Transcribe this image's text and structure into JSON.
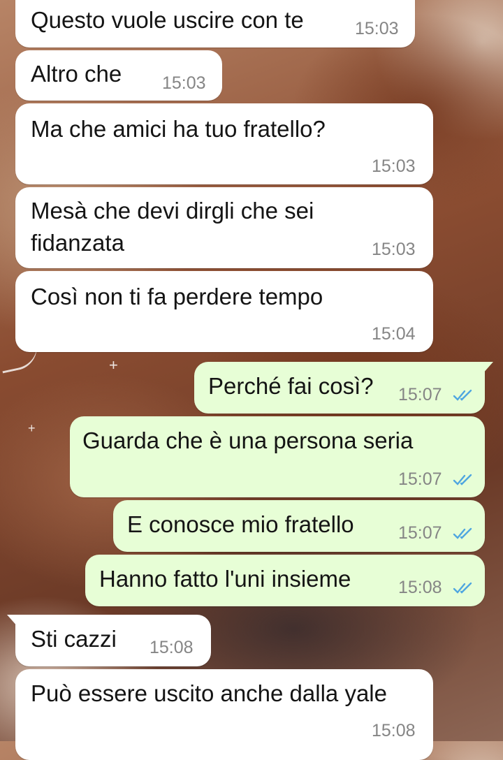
{
  "colors": {
    "incoming_bubble": "#ffffff",
    "outgoing_bubble": "#e7fed6",
    "read_tick": "#4fa6e0",
    "timestamp": "#858585"
  },
  "messages": [
    {
      "direction": "in",
      "text": "Questo vuole uscire con te",
      "time": "15:03"
    },
    {
      "direction": "in",
      "text": "Altro che",
      "time": "15:03"
    },
    {
      "direction": "in",
      "text": "Ma che amici ha tuo fratello?",
      "time": "15:03"
    },
    {
      "direction": "in",
      "text_line1": "Mesà che devi dirgli che sei",
      "text_line2": "fidanzata",
      "time": "15:03"
    },
    {
      "direction": "in",
      "text": "Così non ti fa perdere tempo",
      "time": "15:04"
    },
    {
      "direction": "out",
      "text": "Perché fai così?",
      "time": "15:07",
      "status": "read-double-check-icon"
    },
    {
      "direction": "out",
      "text": "Guarda che è una persona seria",
      "time": "15:07",
      "status": "read-double-check-icon"
    },
    {
      "direction": "out",
      "text": "E conosce mio fratello",
      "time": "15:07",
      "status": "read-double-check-icon"
    },
    {
      "direction": "out",
      "text": "Hanno fatto l'uni insieme",
      "time": "15:08",
      "status": "read-double-check-icon"
    },
    {
      "direction": "in",
      "text": "Sti cazzi",
      "time": "15:08"
    },
    {
      "direction": "in",
      "text": "Può essere uscito anche dalla yale",
      "time": "15:08"
    }
  ]
}
